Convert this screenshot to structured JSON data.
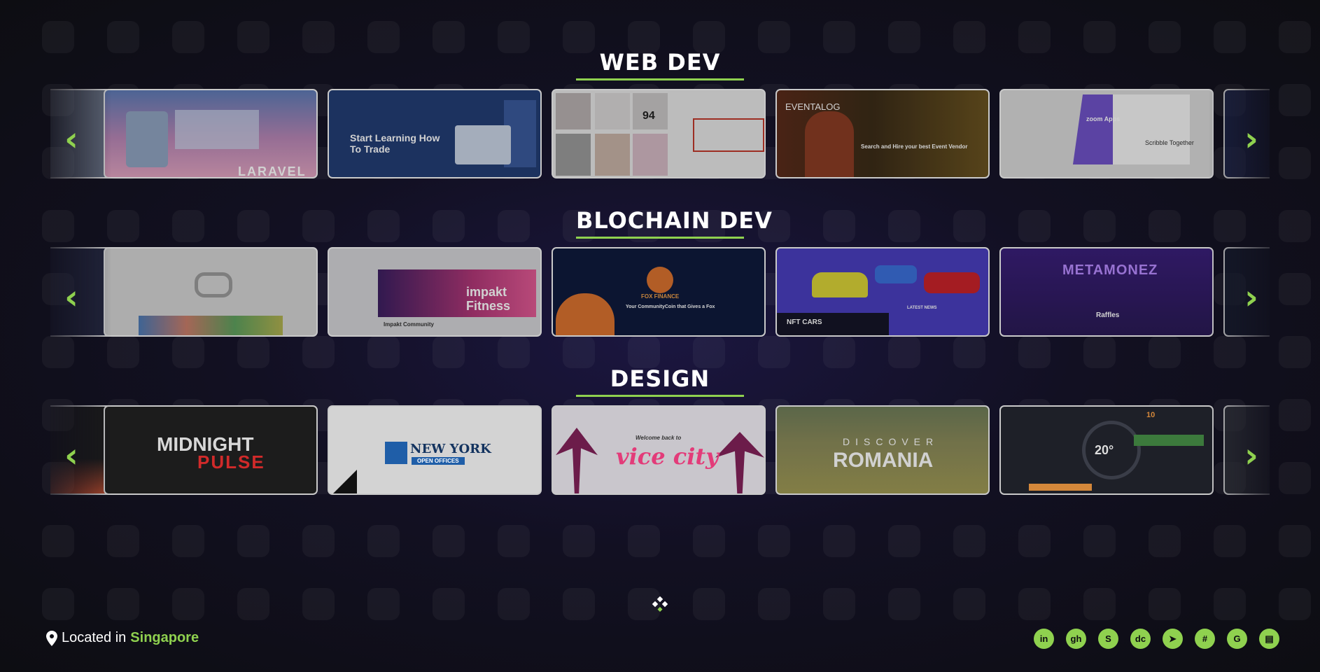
{
  "sections": [
    {
      "title": "WEB DEV",
      "cards": [
        {
          "name": "laravel-project",
          "label": "LARAVEL"
        },
        {
          "name": "trading-platform",
          "label": "Start Learning How To Trade"
        },
        {
          "name": "fashion-shop",
          "label": "94"
        },
        {
          "name": "eventalog",
          "label": "EVENTALOG",
          "sub": "Search and Hire your best Event Vendor"
        },
        {
          "name": "scribble-together",
          "label": "Scribble Together",
          "sub": "zoom Apps"
        }
      ]
    },
    {
      "title": "BLOCHAIN DEV",
      "cards": [
        {
          "name": "infinity-nft",
          "label": ""
        },
        {
          "name": "impakt-fitness",
          "label": "impakt Fitness",
          "sub": "Impakt Community"
        },
        {
          "name": "fox-finance",
          "label": "FOX FINANCE",
          "sub": "Your CommunityCoin that Gives a Fox"
        },
        {
          "name": "nft-cars",
          "label": "NFT CARS",
          "sub": "LATEST NEWS"
        },
        {
          "name": "metamonez",
          "label": "METAMONEZ",
          "sub": "Raffles"
        }
      ]
    },
    {
      "title": "DESIGN",
      "cards": [
        {
          "name": "midnight-pulse",
          "label": "MIDNIGHT",
          "sub": "PULSE"
        },
        {
          "name": "new-york-offices",
          "label": "NEW YORK",
          "sub": "OPEN OFFICES"
        },
        {
          "name": "vice-city",
          "label": "vice city",
          "sub": "Welcome back to"
        },
        {
          "name": "discover-romania",
          "label": "ROMANIA",
          "sub": "DISCOVER"
        },
        {
          "name": "car-dashboard",
          "label": "20°",
          "sub": "10"
        }
      ]
    }
  ],
  "footer": {
    "location_prefix": "Located in",
    "location_city": "Singapore",
    "socials": [
      {
        "name": "linkedin-icon",
        "glyph": "in"
      },
      {
        "name": "github-icon",
        "glyph": "gh"
      },
      {
        "name": "skype-icon",
        "glyph": "S"
      },
      {
        "name": "discord-icon",
        "glyph": "dc"
      },
      {
        "name": "telegram-icon",
        "glyph": "➤"
      },
      {
        "name": "slack-icon",
        "glyph": "#"
      },
      {
        "name": "google-icon",
        "glyph": "G"
      },
      {
        "name": "blog-icon",
        "glyph": "▤"
      }
    ]
  },
  "colors": {
    "accent": "#8fd14f",
    "background": "#0d0d12"
  }
}
